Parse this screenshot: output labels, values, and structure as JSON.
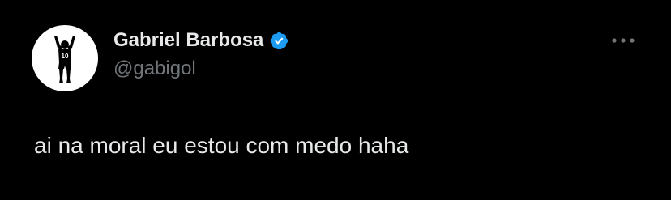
{
  "tweet": {
    "author": {
      "display_name": "Gabriel Barbosa",
      "handle": "@gabigol",
      "verified": true,
      "verified_badge_color": "#1d9bf0",
      "avatar": {
        "icon": "footballer-silhouette-icon",
        "jersey_number": "10",
        "background_color": "#ffffff"
      }
    },
    "more_button": {
      "icon": "more-horizontal-icon"
    },
    "text": "ai na moral eu estou com medo haha"
  },
  "colors": {
    "background": "#000000",
    "primary_text": "#e7e9ea",
    "secondary_text": "#71767b"
  }
}
